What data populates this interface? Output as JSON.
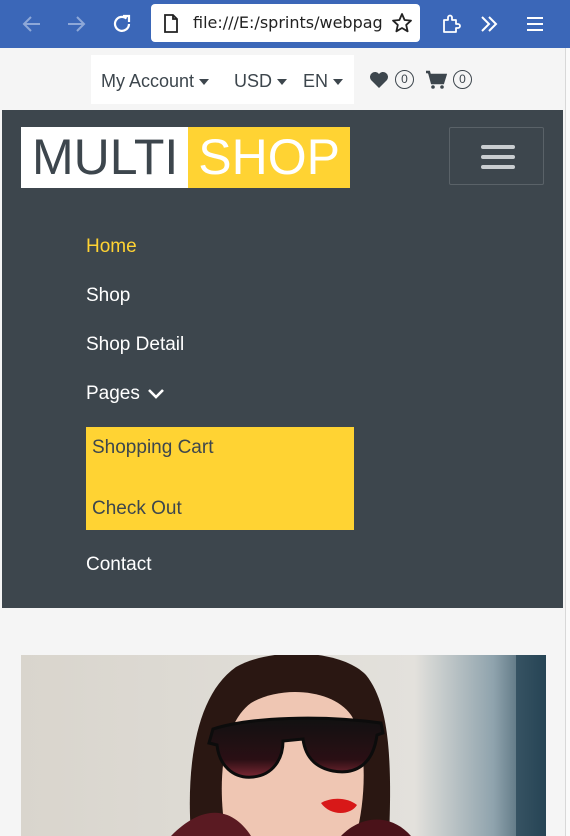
{
  "browser": {
    "url": "file:///E:/sprints/webpages/index.html",
    "back_icon": "arrow-left-icon",
    "forward_icon": "arrow-right-icon",
    "reload_icon": "reload-icon",
    "page_icon": "page-icon",
    "bookmark_icon": "star-icon",
    "extensions_icon": "puzzle-icon",
    "overflow_icon": "chevrons-right-icon",
    "menu_icon": "hamburger-menu-icon"
  },
  "topbar": {
    "account_label": "My Account",
    "currency_label": "USD",
    "language_label": "EN",
    "wishlist_count": "0",
    "cart_count": "0"
  },
  "logo": {
    "part1": "MULTI",
    "part2": "SHOP"
  },
  "nav": {
    "items": [
      {
        "label": "Home",
        "active": true
      },
      {
        "label": "Shop"
      },
      {
        "label": "Shop Detail"
      },
      {
        "label": "Pages"
      },
      {
        "label": "Contact"
      }
    ],
    "pages_dropdown": [
      "Shopping Cart",
      "Check Out"
    ]
  },
  "colors": {
    "primary": "#ffd333",
    "dark": "#3d464d",
    "browser": "#3b67b8",
    "light": "#f5f5f5"
  },
  "hero": {
    "image": "woman-with-sunglasses-photo"
  }
}
